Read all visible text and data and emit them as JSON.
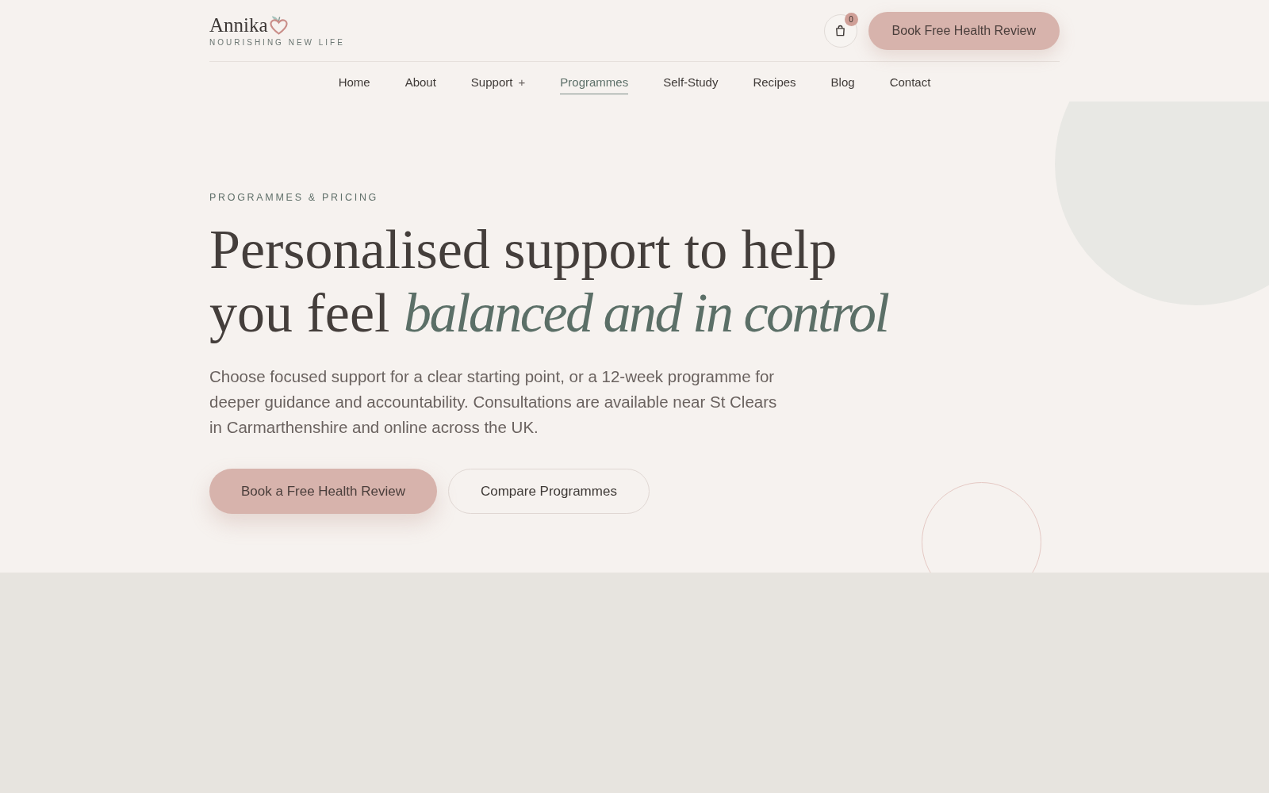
{
  "header": {
    "logo": {
      "name": "Annika",
      "tagline": "NOURISHING NEW LIFE"
    },
    "cart": {
      "count": "0"
    },
    "cta": "Book Free Health Review"
  },
  "nav": [
    {
      "label": "Home",
      "selected": false
    },
    {
      "label": "About",
      "selected": false
    },
    {
      "label": "Support",
      "toggle": "+",
      "selected": false
    },
    {
      "label": "Programmes",
      "selected": true
    },
    {
      "label": "Self-Study",
      "selected": false
    },
    {
      "label": "Recipes",
      "selected": false
    },
    {
      "label": "Blog",
      "selected": false
    },
    {
      "label": "Contact",
      "selected": false
    }
  ],
  "hero": {
    "eyebrow": "PROGRAMMES & PRICING",
    "title": "Personalised support to help you feel *balanced and in control*",
    "intro": "Choose focused support for a clear starting point, or a 12-week programme for deeper guidance and accountability. Consultations are available near St Clears in Carmarthenshire and online across the UK.",
    "buttons": [
      {
        "label": "Book a Free Health Review",
        "kind": "primary"
      },
      {
        "label": "Compare Programmes",
        "kind": "secondary"
      }
    ]
  }
}
